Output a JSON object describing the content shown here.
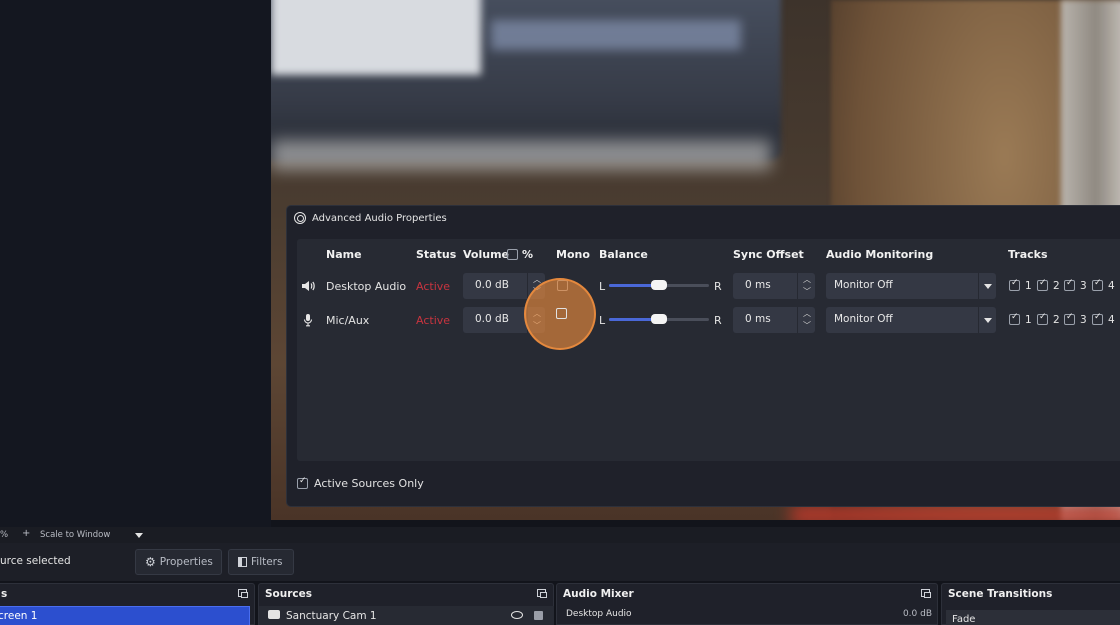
{
  "dialog": {
    "title": "Advanced Audio Properties",
    "headers": {
      "name": "Name",
      "status": "Status",
      "volume": "Volume",
      "volume_unit": "%",
      "mono": "Mono",
      "balance": "Balance",
      "sync_offset": "Sync Offset",
      "audio_monitoring": "Audio Monitoring",
      "tracks": "Tracks"
    },
    "rows": [
      {
        "icon": "speaker-icon",
        "name": "Desktop Audio",
        "status": "Active",
        "volume": "0.0 dB",
        "mono": false,
        "balance_left": "L",
        "balance_right": "R",
        "balance": 0.5,
        "sync_offset": "0 ms",
        "monitoring": "Monitor Off",
        "tracks": [
          "1",
          "2",
          "3",
          "4"
        ]
      },
      {
        "icon": "microphone-icon",
        "name": "Mic/Aux",
        "status": "Active",
        "volume": "0.0 dB",
        "mono": false,
        "balance_left": "L",
        "balance_right": "R",
        "balance": 0.5,
        "sync_offset": "0 ms",
        "monitoring": "Monitor Off",
        "tracks": [
          "1",
          "2",
          "3",
          "4"
        ]
      }
    ],
    "active_sources_only": "Active Sources Only"
  },
  "zoombar": {
    "percent": "%",
    "plus": "+",
    "scale": "Scale to Window"
  },
  "toolbar": {
    "source_selected": "urce selected",
    "properties": "Properties",
    "filters": "Filters"
  },
  "docks": {
    "scenes_title": "s",
    "scene_item": "creen 1",
    "sources_title": "Sources",
    "source_item": "Sanctuary Cam 1",
    "mixer_title": "Audio Mixer",
    "mixer_item": "Desktop Audio",
    "mixer_level": "0.0 dB",
    "transitions_title": "Scene Transitions",
    "transition_item": "Fade"
  },
  "colors": {
    "accent": "#4a68d8",
    "status_active": "#c8343f",
    "cursor_highlight": "#e88b3e"
  }
}
